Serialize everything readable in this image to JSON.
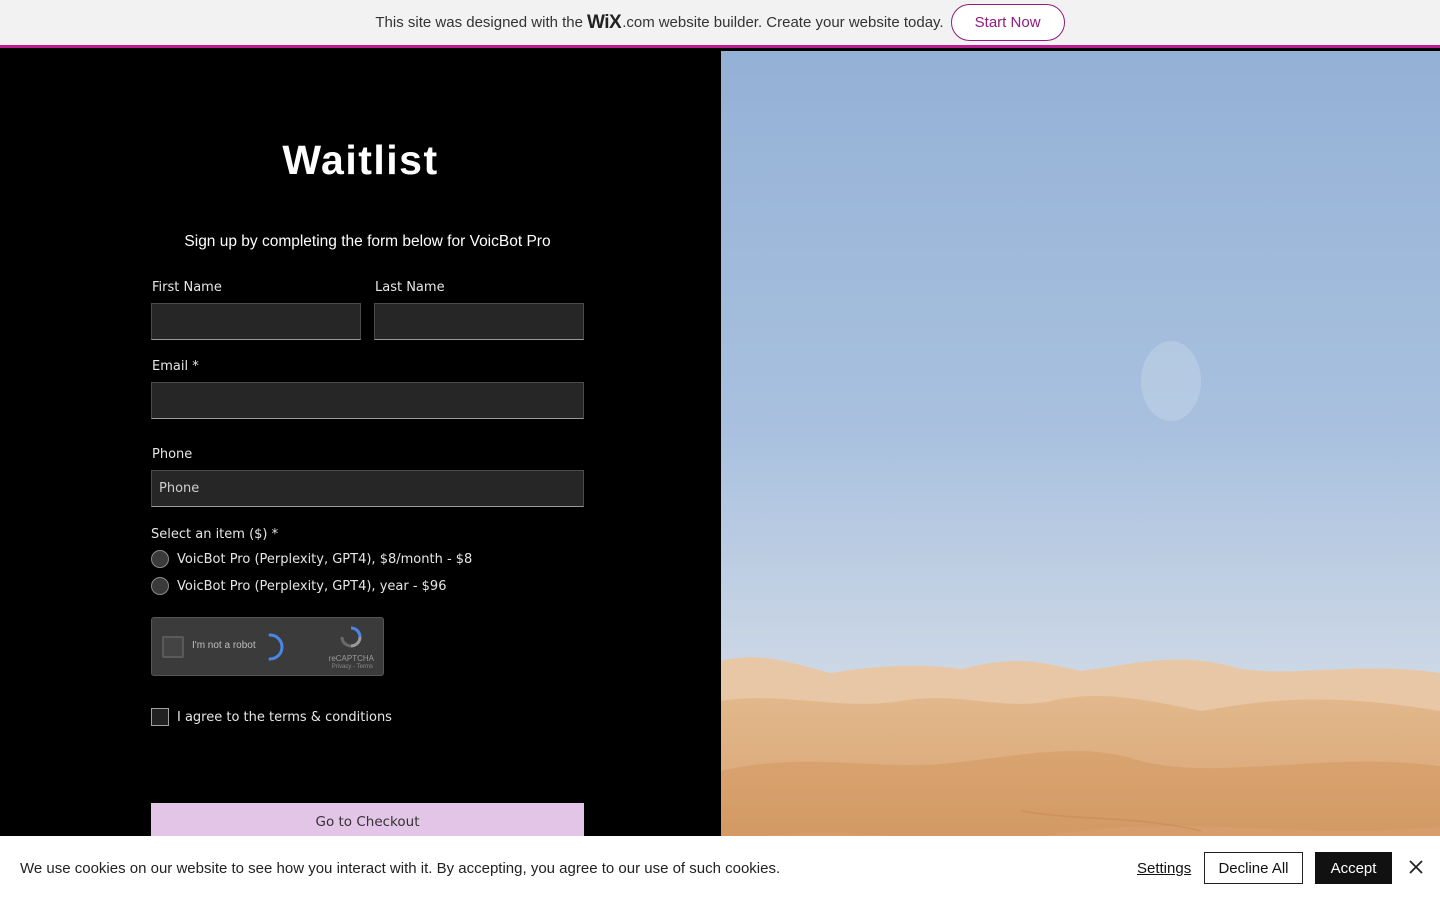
{
  "banner": {
    "prefix": "This site was designed with the",
    "logo": "WiX",
    "dotcom": ".com",
    "suffix": "website builder. Create your website today.",
    "cta": "Start Now",
    "accent": "#8f1c7e"
  },
  "form": {
    "title": "Waitlist",
    "subtitle": "Sign up by completing the form below for VoicBot Pro",
    "first_name_label": "First Name",
    "last_name_label": "Last Name",
    "email_label": "Email *",
    "phone_label": "Phone",
    "phone_placeholder": "Phone",
    "select_label": "Select an item ($) *",
    "options": [
      "VoicBot Pro (Perplexity, GPT4), $8/month - $8",
      "VoicBot Pro (Perplexity, GPT4), year - $96"
    ],
    "captcha": {
      "label": "I'm not a robot",
      "brand": "reCAPTCHA",
      "links": "Privacy - Terms"
    },
    "agree_label": "I agree to the terms & conditions",
    "checkout_label": "Go to Checkout",
    "checkout_color": "#e3c5e8"
  },
  "cookies": {
    "message": "We use cookies on our website to see how you interact with it. By accepting, you agree to our use of such cookies.",
    "settings": "Settings",
    "decline": "Decline All",
    "accept": "Accept"
  },
  "icons": {
    "close": "close-icon",
    "captcha_logo": "recaptcha-logo-icon",
    "spinner": "loading-spinner-icon"
  }
}
